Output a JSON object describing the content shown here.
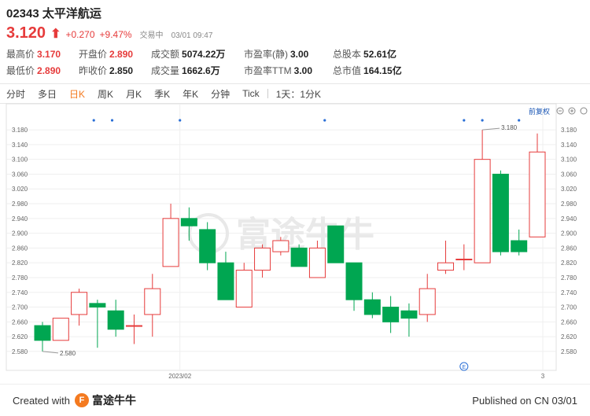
{
  "header": {
    "code": "02343",
    "name": "太平洋航运",
    "price": "3.120",
    "change": "+0.270",
    "change_pct": "+9.47%",
    "status": "交易中",
    "time": "03/01 09:47"
  },
  "stats": [
    {
      "label": "最高价",
      "value": "3.170",
      "tone": "red"
    },
    {
      "label": "开盘价",
      "value": "2.890",
      "tone": "red"
    },
    {
      "label": "成交额",
      "value": "5074.22万",
      "tone": "dark"
    },
    {
      "label": "市盈率(静)",
      "value": "3.00",
      "tone": "dark"
    },
    {
      "label": "总股本",
      "value": "52.61亿",
      "tone": "dark"
    },
    {
      "label": "最低价",
      "value": "2.890",
      "tone": "red"
    },
    {
      "label": "昨收价",
      "value": "2.850",
      "tone": "dark"
    },
    {
      "label": "成交量",
      "value": "1662.6万",
      "tone": "dark"
    },
    {
      "label": "市盈率TTM",
      "value": "3.00",
      "tone": "dark"
    },
    {
      "label": "总市值",
      "value": "164.15亿",
      "tone": "dark"
    }
  ],
  "tabs": [
    "分时",
    "多日",
    "日K",
    "周K",
    "月K",
    "季K",
    "年K",
    "分钟",
    "Tick"
  ],
  "active_tab": "日K",
  "period_selector": "1天：1分K",
  "adjust_label": "前复权",
  "watermark": "富途牛牛",
  "colors": {
    "up": "#e63b3b",
    "down": "#00a651",
    "accent": "#f47a20"
  },
  "chart_data": {
    "type": "candlestick",
    "ylim": [
      2.55,
      3.21
    ],
    "yticks": [
      "3.180",
      "3.140",
      "3.100",
      "3.060",
      "3.020",
      "2.980",
      "2.940",
      "2.900",
      "2.860",
      "2.820",
      "2.780",
      "2.740",
      "2.700",
      "2.660",
      "2.620",
      "2.580"
    ],
    "x_labels": [
      {
        "label": "2023/02",
        "index": 7.5
      },
      {
        "label": "3",
        "index": 27.3
      }
    ],
    "high_marker": {
      "label": "3.180",
      "index": 24
    },
    "low_marker": {
      "label": "2.580",
      "index": 0
    },
    "dividend_marker": {
      "label": "E",
      "index": 23
    },
    "candles": [
      {
        "o": 2.65,
        "h": 2.66,
        "l": 2.58,
        "c": 2.61
      },
      {
        "o": 2.61,
        "h": 2.67,
        "l": 2.61,
        "c": 2.67
      },
      {
        "o": 2.68,
        "h": 2.75,
        "l": 2.65,
        "c": 2.74
      },
      {
        "o": 2.71,
        "h": 2.72,
        "l": 2.59,
        "c": 2.7
      },
      {
        "o": 2.69,
        "h": 2.72,
        "l": 2.62,
        "c": 2.64
      },
      {
        "o": 2.65,
        "h": 2.68,
        "l": 2.6,
        "c": 2.65
      },
      {
        "o": 2.68,
        "h": 2.79,
        "l": 2.62,
        "c": 2.75
      },
      {
        "o": 2.81,
        "h": 2.98,
        "l": 2.81,
        "c": 2.94
      },
      {
        "o": 2.94,
        "h": 2.97,
        "l": 2.88,
        "c": 2.92
      },
      {
        "o": 2.91,
        "h": 2.93,
        "l": 2.8,
        "c": 2.82
      },
      {
        "o": 2.82,
        "h": 2.85,
        "l": 2.72,
        "c": 2.72
      },
      {
        "o": 2.7,
        "h": 2.82,
        "l": 2.7,
        "c": 2.8
      },
      {
        "o": 2.8,
        "h": 2.87,
        "l": 2.78,
        "c": 2.86
      },
      {
        "o": 2.85,
        "h": 2.89,
        "l": 2.84,
        "c": 2.88
      },
      {
        "o": 2.86,
        "h": 2.87,
        "l": 2.81,
        "c": 2.81
      },
      {
        "o": 2.78,
        "h": 2.88,
        "l": 2.78,
        "c": 2.86
      },
      {
        "o": 2.92,
        "h": 2.92,
        "l": 2.82,
        "c": 2.82
      },
      {
        "o": 2.82,
        "h": 2.82,
        "l": 2.69,
        "c": 2.72
      },
      {
        "o": 2.72,
        "h": 2.74,
        "l": 2.67,
        "c": 2.68
      },
      {
        "o": 2.7,
        "h": 2.73,
        "l": 2.63,
        "c": 2.66
      },
      {
        "o": 2.69,
        "h": 2.71,
        "l": 2.62,
        "c": 2.67
      },
      {
        "o": 2.68,
        "h": 2.79,
        "l": 2.66,
        "c": 2.75
      },
      {
        "o": 2.8,
        "h": 2.88,
        "l": 2.79,
        "c": 2.82
      },
      {
        "o": 2.83,
        "h": 2.87,
        "l": 2.8,
        "c": 2.83
      },
      {
        "o": 2.82,
        "h": 3.18,
        "l": 2.82,
        "c": 3.1
      },
      {
        "o": 3.06,
        "h": 3.07,
        "l": 2.84,
        "c": 2.85
      },
      {
        "o": 2.88,
        "h": 2.91,
        "l": 2.84,
        "c": 2.85
      },
      {
        "o": 2.89,
        "h": 3.17,
        "l": 2.89,
        "c": 3.12
      }
    ]
  },
  "footer": {
    "created_with": "Created with",
    "brand": "富途牛牛",
    "published": "Published on CN 03/01"
  }
}
